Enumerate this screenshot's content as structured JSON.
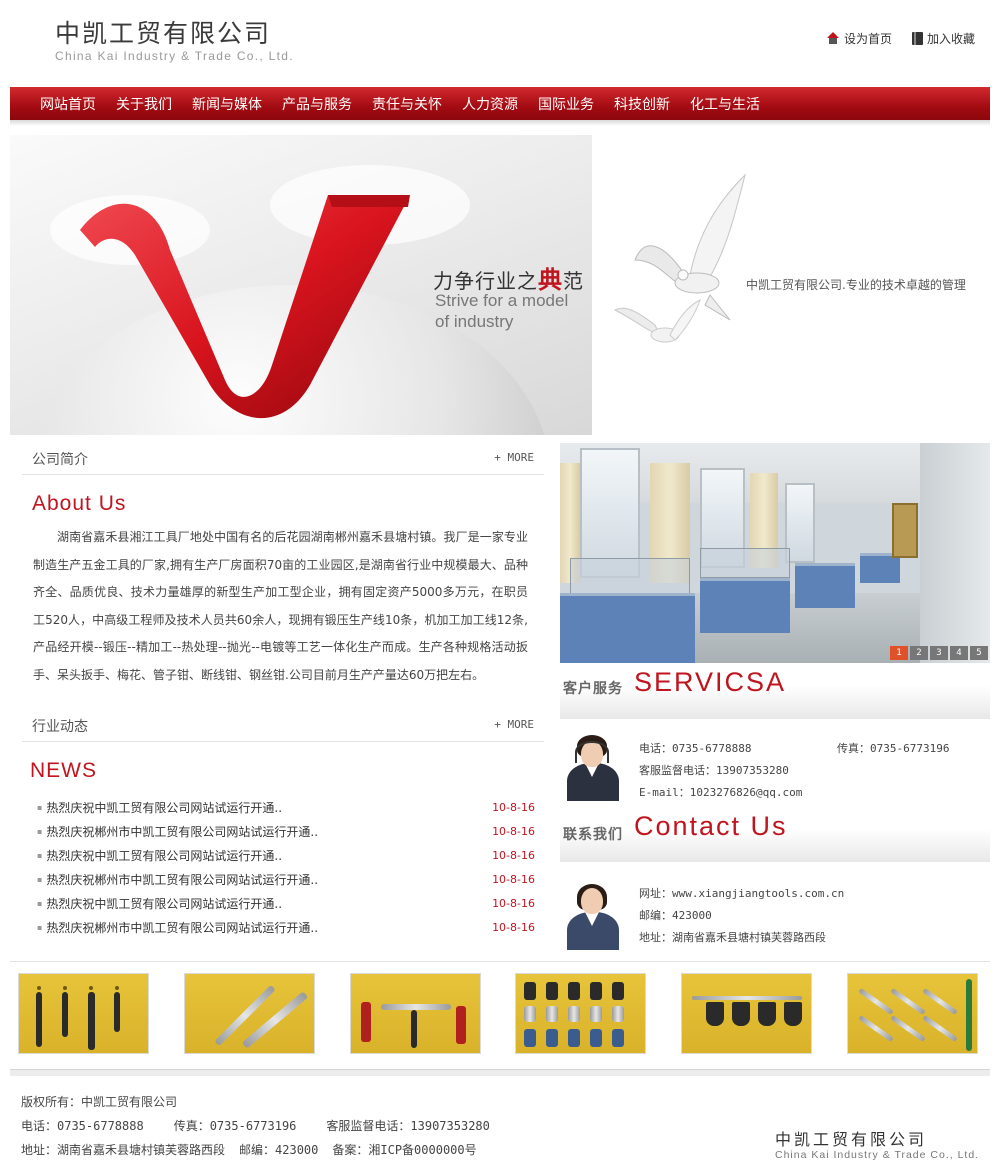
{
  "header": {
    "logo_cn": "中凯工贸有限公司",
    "logo_en": "China Kai Industry & Trade Co., Ltd.",
    "set_home": "设为首页",
    "add_favorite": "加入收藏"
  },
  "nav": {
    "items": [
      "网站首页",
      "关于我们",
      "新闻与媒体",
      "产品与服务",
      "责任与关怀",
      "人力资源",
      "国际业务",
      "科技创新",
      "化工与生活"
    ]
  },
  "banner": {
    "slogan_cn_prefix": "力争行业之",
    "slogan_cn_bold": "典",
    "slogan_cn_suffix": "范",
    "slogan_en_line1": "Strive for a model",
    "slogan_en_line2": "of industry",
    "tagline": "中凯工贸有限公司.专业的技术卓越的管理"
  },
  "intro": {
    "title": "公司简介",
    "more": "+ MORE",
    "heading": "About Us",
    "text": "湖南省嘉禾县湘江工具厂地处中国有名的后花园湖南郴州嘉禾县塘村镇。我厂是一家专业制造生产五金工具的厂家,拥有生产厂房面积70亩的工业园区,是湖南省行业中规模最大、品种齐全、品质优良、技术力量雄厚的新型生产加工型企业，拥有固定资产5000多万元，在职员工520人，中高级工程师及技术人员共60余人，现拥有锻压生产线10条，机加工加工线12条,产品经开模--锻压--精加工--热处理--抛光--电镀等工艺一体化生产而成。生产各种规格活动扳手、呆头扳手、梅花、管子钳、断线钳、钢丝钳.公司目前月生产产量达60万把左右。"
  },
  "news": {
    "title": "行业动态",
    "more": "+ MORE",
    "heading": "NEWS",
    "items": [
      {
        "title": "热烈庆祝中凯工贸有限公司网站试运行开通..",
        "date": "10-8-16"
      },
      {
        "title": "热烈庆祝郴州市中凯工贸有限公司网站试运行开通..",
        "date": "10-8-16"
      },
      {
        "title": "热烈庆祝中凯工贸有限公司网站试运行开通..",
        "date": "10-8-16"
      },
      {
        "title": "热烈庆祝郴州市中凯工贸有限公司网站试运行开通..",
        "date": "10-8-16"
      },
      {
        "title": "热烈庆祝中凯工贸有限公司网站试运行开通..",
        "date": "10-8-16"
      },
      {
        "title": "热烈庆祝郴州市中凯工贸有限公司网站试运行开通..",
        "date": "10-8-16"
      }
    ]
  },
  "slideshow": {
    "pages": [
      "1",
      "2",
      "3",
      "4",
      "5"
    ],
    "active_page": 1
  },
  "service": {
    "label_cn": "客户服务",
    "label_en": "SERVICSA",
    "phone": "电话：0735-6778888",
    "fax": "传真：0735-6773196",
    "supervise": "客服监督电话：13907353280",
    "email": "E-mail：1023276826@qq.com"
  },
  "contact": {
    "label_cn": "联系我们",
    "label_en": "Contact Us",
    "website": "网址：www.xiangjiangtools.com.cn",
    "postcode": "邮编：423000",
    "address": "地址：湖南省嘉禾县塘村镇芙蓉路西段"
  },
  "footer": {
    "copyright": "版权所有：中凯工贸有限公司",
    "phone": "电话：0735-6778888",
    "fax": "传真：0735-6773196",
    "supervise": "客服监督电话：13907353280",
    "address": "地址：湖南省嘉禾县塘村镇芙蓉路西段",
    "postcode": "邮编：423000",
    "icp": "备案：湘ICP备0000000号",
    "logo_cn": "中凯工贸有限公司",
    "logo_en": "China Kai Industry & Trade Co., Ltd."
  },
  "colors": {
    "brand_red": "#c0151f",
    "nav_red": "#a30b12",
    "pager_active": "#e0512a"
  }
}
